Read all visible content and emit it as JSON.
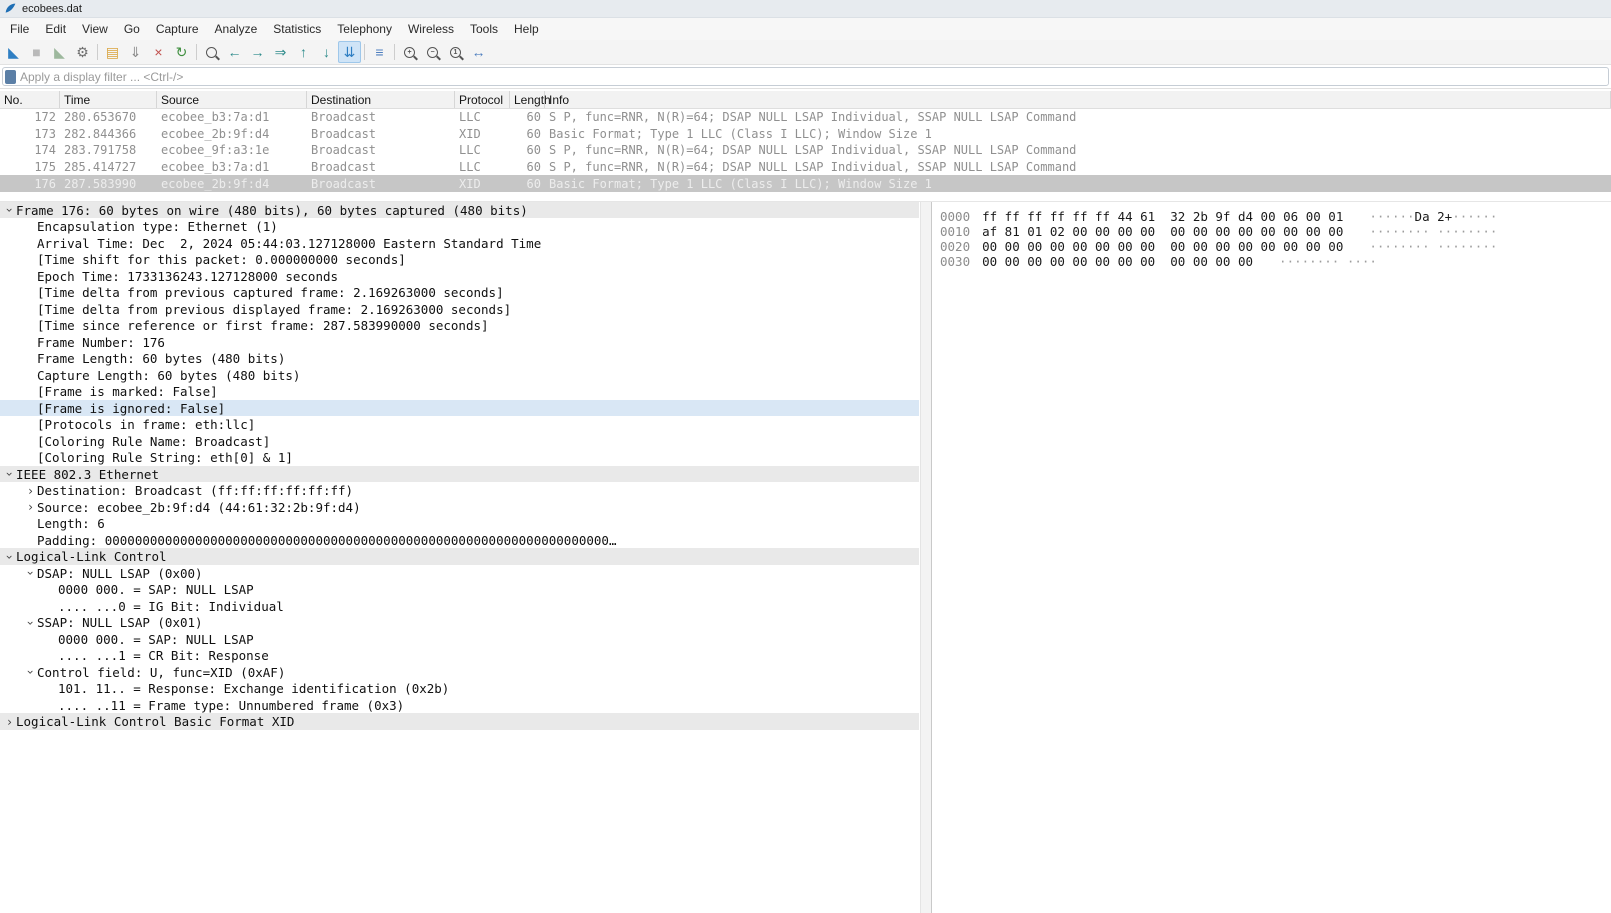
{
  "colors": {
    "accent_blue": "#2f7fc3",
    "selection_inactive": "#c6c6c6",
    "related_field_blue": "#d9e7f5",
    "section_gray": "#e9e9e9",
    "broadcast_row_text": "#909090"
  },
  "window": {
    "title": "ecobees.dat"
  },
  "menu": {
    "items": [
      "File",
      "Edit",
      "View",
      "Go",
      "Capture",
      "Analyze",
      "Statistics",
      "Telephony",
      "Wireless",
      "Tools",
      "Help"
    ]
  },
  "toolbar": {
    "items": [
      {
        "name": "start-capture",
        "glyph": "◣",
        "color": "#2f7fc3"
      },
      {
        "name": "stop-capture",
        "glyph": "■",
        "color": "#b9b9b9"
      },
      {
        "name": "restart-capture",
        "glyph": "◣",
        "color": "#9db89d"
      },
      {
        "name": "capture-options",
        "glyph": "⚙",
        "color": "#6f6f6f"
      },
      {
        "sep": true
      },
      {
        "name": "open-file",
        "glyph": "▤",
        "color": "#d9a33c"
      },
      {
        "name": "save-file",
        "glyph": "⇓",
        "color": "#8a8a8a"
      },
      {
        "name": "close-file",
        "glyph": "×",
        "color": "#c0504d"
      },
      {
        "name": "reload-file",
        "glyph": "↻",
        "color": "#3f8f3f"
      },
      {
        "sep": true
      },
      {
        "name": "find-packet",
        "mag": ""
      },
      {
        "name": "go-back",
        "glyph": "←",
        "color": "#2e8b8b"
      },
      {
        "name": "go-forward",
        "glyph": "→",
        "color": "#2e8b8b"
      },
      {
        "name": "go-to-packet",
        "glyph": "⇒",
        "color": "#2e8b8b"
      },
      {
        "name": "go-first-packet",
        "glyph": "↑",
        "color": "#2e8b8b"
      },
      {
        "name": "go-last-packet",
        "glyph": "↓",
        "color": "#2e8b8b"
      },
      {
        "name": "auto-scroll",
        "glyph": "⇊",
        "color": "#2f7fc3",
        "pressed": true
      },
      {
        "sep": true
      },
      {
        "name": "colorize-packets",
        "glyph": "≡",
        "color": "#4f7fbf"
      },
      {
        "sep": true
      },
      {
        "name": "zoom-in",
        "mag": "+"
      },
      {
        "name": "zoom-out",
        "mag": "−"
      },
      {
        "name": "zoom-original",
        "mag": "1"
      },
      {
        "name": "resize-columns",
        "glyph": "↔",
        "color": "#4f7fbf"
      }
    ]
  },
  "filter": {
    "placeholder": "Apply a display filter ... <Ctrl-/>"
  },
  "packet_list": {
    "columns": [
      "No.",
      "Time",
      "Source",
      "Destination",
      "Protocol",
      "Length",
      "Info"
    ],
    "selected_no": "176",
    "rows": [
      {
        "no": "172",
        "time": "280.653670",
        "source": "ecobee_b3:7a:d1",
        "destination": "Broadcast",
        "protocol": "LLC",
        "length": "60",
        "info": "S P, func=RNR, N(R)=64; DSAP NULL LSAP Individual, SSAP NULL LSAP Command"
      },
      {
        "no": "173",
        "time": "282.844366",
        "source": "ecobee_2b:9f:d4",
        "destination": "Broadcast",
        "protocol": "XID",
        "length": "60",
        "info": "Basic Format; Type 1 LLC (Class I LLC); Window Size 1"
      },
      {
        "no": "174",
        "time": "283.791758",
        "source": "ecobee_9f:a3:1e",
        "destination": "Broadcast",
        "protocol": "LLC",
        "length": "60",
        "info": "S P, func=RNR, N(R)=64; DSAP NULL LSAP Individual, SSAP NULL LSAP Command"
      },
      {
        "no": "175",
        "time": "285.414727",
        "source": "ecobee_b3:7a:d1",
        "destination": "Broadcast",
        "protocol": "LLC",
        "length": "60",
        "info": "S P, func=RNR, N(R)=64; DSAP NULL LSAP Individual, SSAP NULL LSAP Command"
      },
      {
        "no": "176",
        "time": "287.583990",
        "source": "ecobee_2b:9f:d4",
        "destination": "Broadcast",
        "protocol": "XID",
        "length": "60",
        "info": "Basic Format; Type 1 LLC (Class I LLC); Window Size 1"
      }
    ]
  },
  "details": {
    "lines": [
      {
        "depth": 0,
        "chev": "open",
        "style": "section",
        "text": "Frame 176: 60 bytes on wire (480 bits), 60 bytes captured (480 bits)"
      },
      {
        "depth": 1,
        "chev": "none",
        "style": "",
        "text": "Encapsulation type: Ethernet (1)"
      },
      {
        "depth": 1,
        "chev": "none",
        "style": "",
        "text": "Arrival Time: Dec  2, 2024 05:44:03.127128000 Eastern Standard Time"
      },
      {
        "depth": 1,
        "chev": "none",
        "style": "",
        "text": "[Time shift for this packet: 0.000000000 seconds]"
      },
      {
        "depth": 1,
        "chev": "none",
        "style": "",
        "text": "Epoch Time: 1733136243.127128000 seconds"
      },
      {
        "depth": 1,
        "chev": "none",
        "style": "",
        "text": "[Time delta from previous captured frame: 2.169263000 seconds]"
      },
      {
        "depth": 1,
        "chev": "none",
        "style": "",
        "text": "[Time delta from previous displayed frame: 2.169263000 seconds]"
      },
      {
        "depth": 1,
        "chev": "none",
        "style": "",
        "text": "[Time since reference or first frame: 287.583990000 seconds]"
      },
      {
        "depth": 1,
        "chev": "none",
        "style": "",
        "text": "Frame Number: 176"
      },
      {
        "depth": 1,
        "chev": "none",
        "style": "",
        "text": "Frame Length: 60 bytes (480 bits)"
      },
      {
        "depth": 1,
        "chev": "none",
        "style": "",
        "text": "Capture Length: 60 bytes (480 bits)"
      },
      {
        "depth": 1,
        "chev": "none",
        "style": "",
        "text": "[Frame is marked: False]"
      },
      {
        "depth": 1,
        "chev": "none",
        "style": "selected",
        "text": "[Frame is ignored: False]"
      },
      {
        "depth": 1,
        "chev": "none",
        "style": "",
        "text": "[Protocols in frame: eth:llc]"
      },
      {
        "depth": 1,
        "chev": "none",
        "style": "",
        "text": "[Coloring Rule Name: Broadcast]"
      },
      {
        "depth": 1,
        "chev": "none",
        "style": "",
        "text": "[Coloring Rule String: eth[0] & 1]"
      },
      {
        "depth": 0,
        "chev": "open",
        "style": "section",
        "text": "IEEE 802.3 Ethernet"
      },
      {
        "depth": 1,
        "chev": "closed",
        "style": "",
        "text": "Destination: Broadcast (ff:ff:ff:ff:ff:ff)"
      },
      {
        "depth": 1,
        "chev": "closed",
        "style": "",
        "text": "Source: ecobee_2b:9f:d4 (44:61:32:2b:9f:d4)"
      },
      {
        "depth": 1,
        "chev": "none",
        "style": "",
        "text": "Length: 6"
      },
      {
        "depth": 1,
        "chev": "none",
        "style": "",
        "text": "Padding: 0000000000000000000000000000000000000000000000000000000000000000000…"
      },
      {
        "depth": 0,
        "chev": "open",
        "style": "section",
        "text": "Logical-Link Control"
      },
      {
        "depth": 1,
        "chev": "open",
        "style": "",
        "text": "DSAP: NULL LSAP (0x00)"
      },
      {
        "depth": 2,
        "chev": "none",
        "style": "",
        "text": "0000 000. = SAP: NULL LSAP"
      },
      {
        "depth": 2,
        "chev": "none",
        "style": "",
        "text": ".... ...0 = IG Bit: Individual"
      },
      {
        "depth": 1,
        "chev": "open",
        "style": "",
        "text": "SSAP: NULL LSAP (0x01)"
      },
      {
        "depth": 2,
        "chev": "none",
        "style": "",
        "text": "0000 000. = SAP: NULL LSAP"
      },
      {
        "depth": 2,
        "chev": "none",
        "style": "",
        "text": ".... ...1 = CR Bit: Response"
      },
      {
        "depth": 1,
        "chev": "open",
        "style": "",
        "text": "Control field: U, func=XID (0xAF)"
      },
      {
        "depth": 2,
        "chev": "none",
        "style": "",
        "text": "101. 11.. = Response: Exchange identification (0x2b)"
      },
      {
        "depth": 2,
        "chev": "none",
        "style": "",
        "text": ".... ..11 = Frame type: Unnumbered frame (0x3)"
      },
      {
        "depth": 0,
        "chev": "closed",
        "style": "section",
        "text": "Logical-Link Control Basic Format XID"
      }
    ]
  },
  "hex": {
    "rows": [
      {
        "offset": "0000",
        "bytes": "ff ff ff ff ff ff 44 61  32 2b 9f d4 00 06 00 01",
        "ascii": "······Da 2+······"
      },
      {
        "offset": "0010",
        "bytes": "af 81 01 02 00 00 00 00  00 00 00 00 00 00 00 00",
        "ascii": "········ ········"
      },
      {
        "offset": "0020",
        "bytes": "00 00 00 00 00 00 00 00  00 00 00 00 00 00 00 00",
        "ascii": "········ ········"
      },
      {
        "offset": "0030",
        "bytes": "00 00 00 00 00 00 00 00  00 00 00 00",
        "ascii": "········ ····"
      }
    ]
  }
}
